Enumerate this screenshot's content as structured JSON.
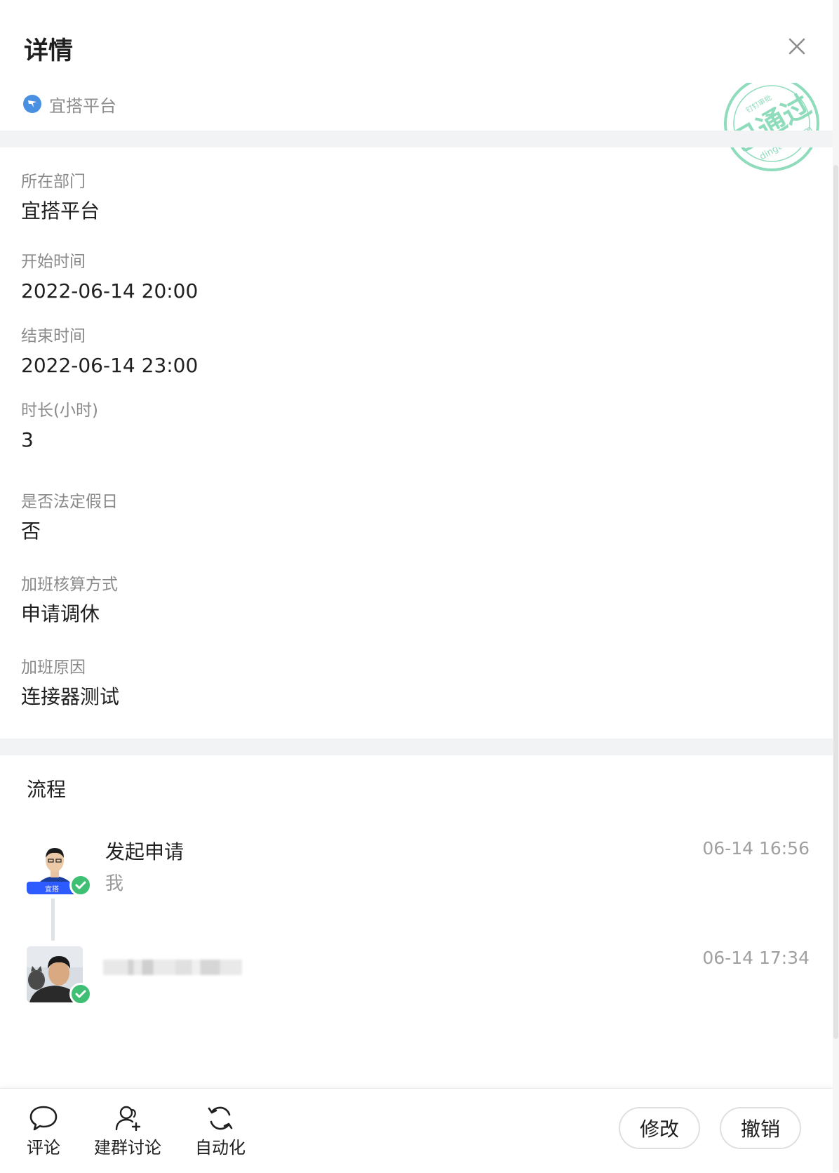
{
  "header": {
    "title": "详情"
  },
  "app": {
    "name": "宜搭平台"
  },
  "stamp": {
    "text": "已通过",
    "domain": "dingtalk.com",
    "small": "钉钉审批",
    "color": "#8fdcbc"
  },
  "fields": [
    {
      "label": "所在部门",
      "value": "宜搭平台"
    },
    {
      "label": "开始时间",
      "value": "2022-06-14 20:00"
    },
    {
      "label": "结束时间",
      "value": "2022-06-14 23:00"
    },
    {
      "label": "时长(小时)",
      "value": "3"
    },
    {
      "label": "是否法定假日",
      "value": "否"
    },
    {
      "label": "加班核算方式",
      "value": "申请调休"
    },
    {
      "label": "加班原因",
      "value": "连接器测试"
    }
  ],
  "flow": {
    "title": "流程",
    "items": [
      {
        "title": "发起申请",
        "sub": "我",
        "time": "06-14 16:56",
        "avatar_badge": "宜搭"
      },
      {
        "title": "",
        "sub": "",
        "time": "06-14 17:34"
      }
    ]
  },
  "toolbar": {
    "comment_label": "评论",
    "group_label": "建群讨论",
    "automation_label": "自动化",
    "edit_label": "修改",
    "revoke_label": "撤销"
  },
  "colors": {
    "success": "#3fbf73",
    "app_icon": "#4a90e2",
    "muted": "#8a8a8a"
  }
}
